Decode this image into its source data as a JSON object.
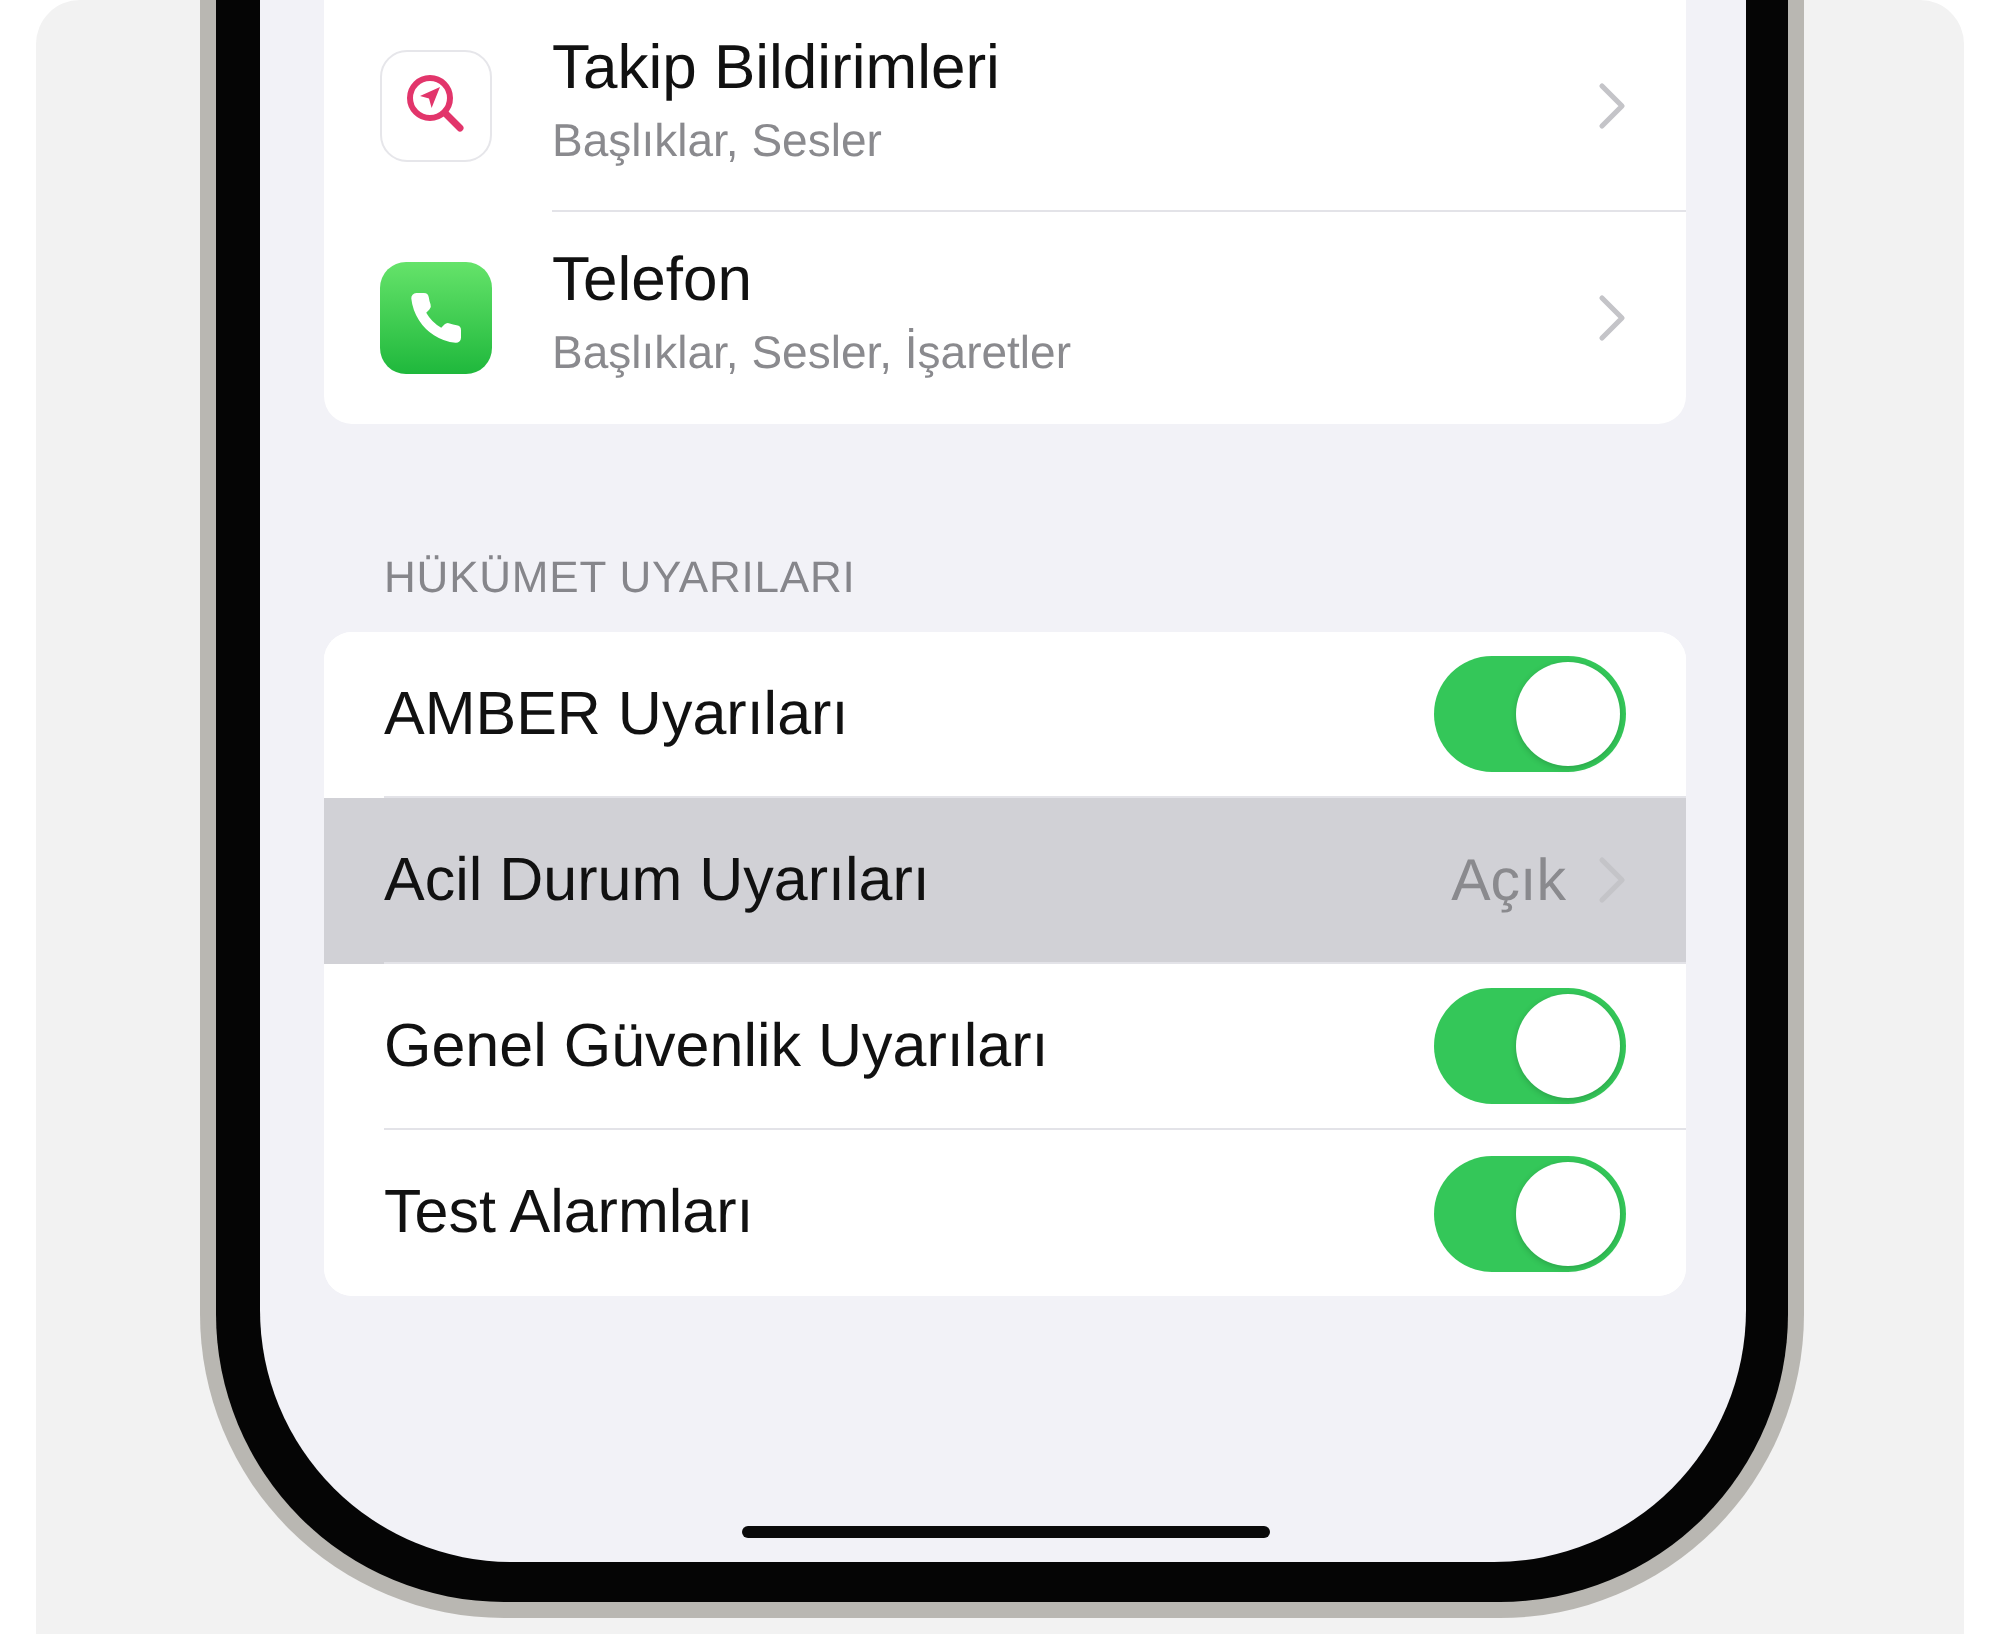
{
  "notification_apps": [
    {
      "title": "Takip Bildirimleri",
      "subtitle": "Başlıklar, Sesler"
    },
    {
      "title": "Telefon",
      "subtitle": "Başlıklar, Sesler, İşaretler"
    }
  ],
  "government_alerts": {
    "header": "HÜKÜMET UYARILARI",
    "items": [
      {
        "kind": "toggle",
        "label": "AMBER Uyarıları",
        "on": true,
        "selected": false
      },
      {
        "kind": "link",
        "label": "Acil Durum Uyarıları",
        "value": "Açık",
        "selected": true
      },
      {
        "kind": "toggle",
        "label": "Genel Güvenlik Uyarıları",
        "on": true,
        "selected": false
      },
      {
        "kind": "toggle",
        "label": "Test Alarmları",
        "on": true,
        "selected": false
      }
    ]
  }
}
